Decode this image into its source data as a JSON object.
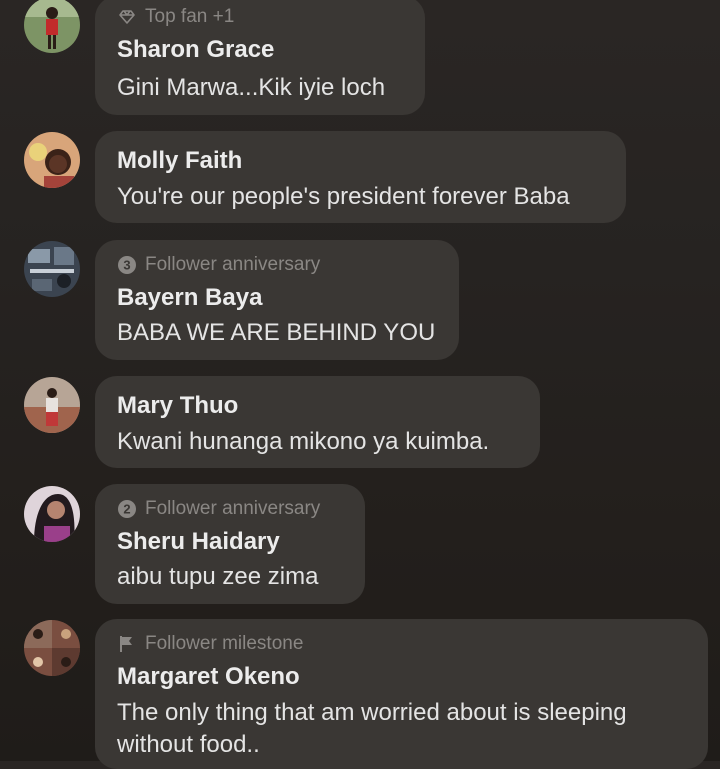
{
  "comments": [
    {
      "badge": "Top fan +1",
      "badge_icon": "diamond-icon",
      "name": "Sharon Grace",
      "text": "Gini Marwa...Kik iyie loch",
      "avatar_color": "#6f8a5a"
    },
    {
      "badge": "",
      "name": "Molly Faith",
      "text": "You're our people's president forever Baba",
      "avatar_color": "#c98a5a"
    },
    {
      "badge": "Follower anniversary",
      "badge_icon": "number-3-icon",
      "name": "Bayern Baya",
      "text": "BABA WE ARE BEHIND YOU",
      "avatar_color": "#4a5563"
    },
    {
      "badge": "",
      "name": "Mary Thuo",
      "text": "Kwani hunanga mikono ya kuimba.",
      "avatar_color": "#b86a5a"
    },
    {
      "badge": "Follower anniversary",
      "badge_icon": "number-2-icon",
      "name": "Sheru Haidary",
      "text": "aibu tupu zee zima",
      "avatar_color": "#c9b8c4"
    },
    {
      "badge": "Follower milestone",
      "badge_icon": "flag-icon",
      "name": "Margaret Okeno",
      "text": "The only thing that am worried about is sleeping without food..",
      "avatar_color": "#8a5a4a"
    }
  ]
}
